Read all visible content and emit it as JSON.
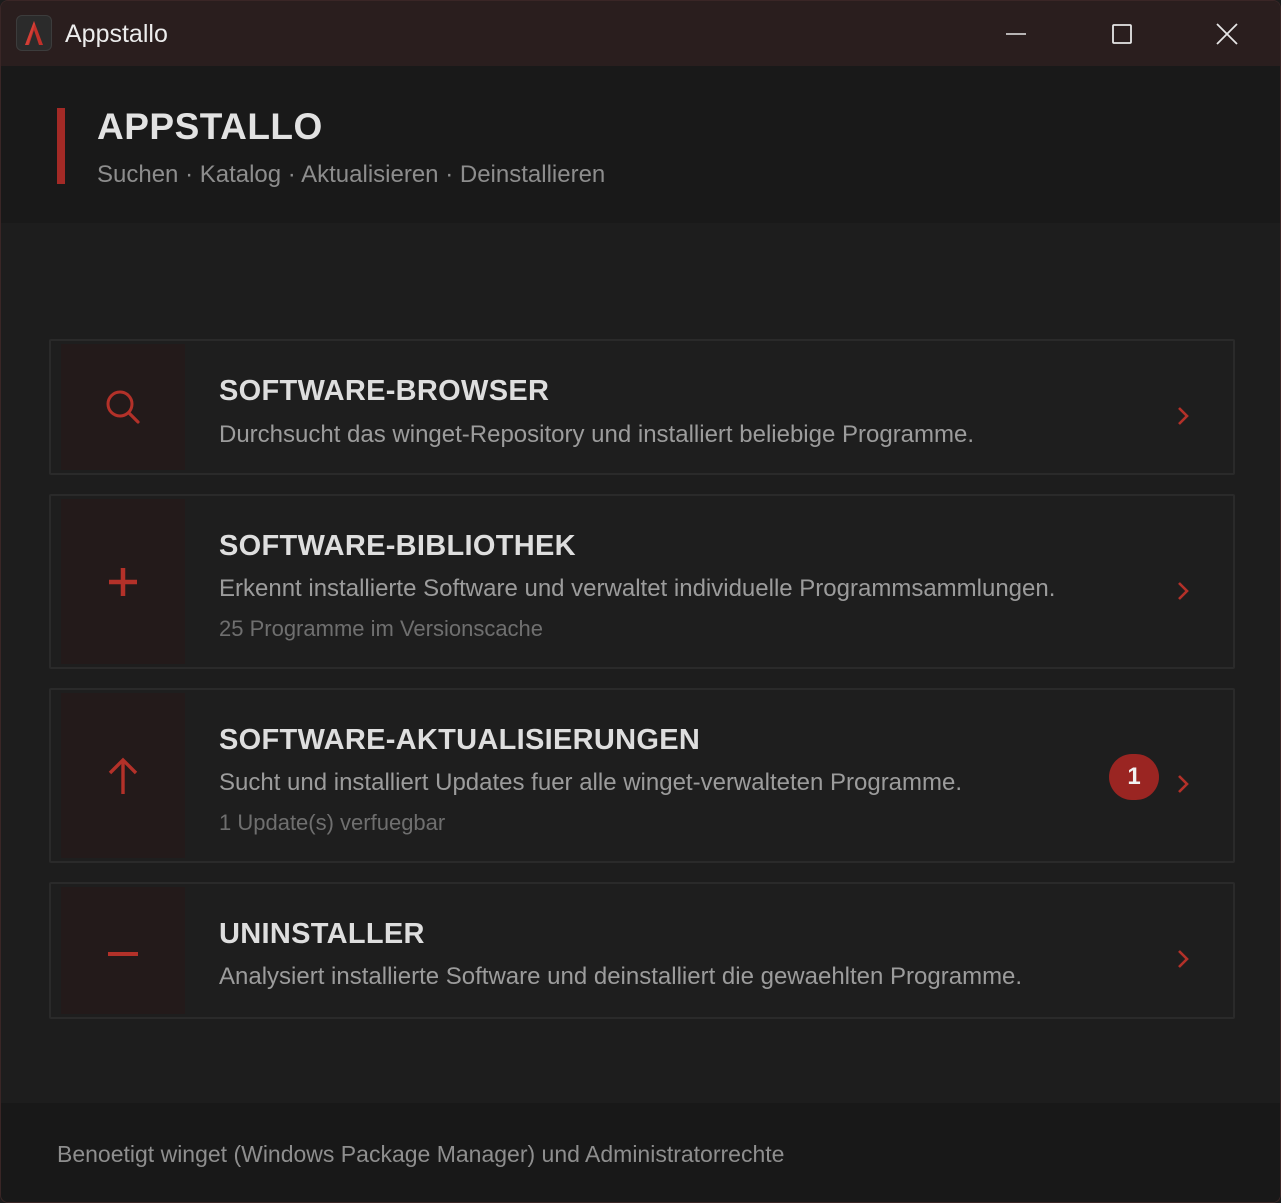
{
  "window": {
    "title": "Appstallo",
    "controls": {
      "minimize": "minimize",
      "maximize": "maximize",
      "close": "close"
    }
  },
  "header": {
    "title": "APPSTALLO",
    "subtitle": "Suchen · Katalog · Aktualisieren · Deinstallieren"
  },
  "cards": [
    {
      "title": "SOFTWARE-BROWSER",
      "description": "Durchsucht das winget-Repository und installiert beliebige Programme.",
      "icon": "search-icon"
    },
    {
      "title": "SOFTWARE-BIBLIOTHEK",
      "description": "Erkennt installierte Software und verwaltet individuelle Programmsammlungen.",
      "meta": "25 Programme im Versionscache",
      "icon": "plus-icon"
    },
    {
      "title": "SOFTWARE-AKTUALISIERUNGEN",
      "description": "Sucht und installiert Updates fuer alle winget-verwalteten Programme.",
      "meta": "1 Update(s) verfuegbar",
      "badge": "1",
      "icon": "arrow-up-icon"
    },
    {
      "title": "UNINSTALLER",
      "description": "Analysiert installierte Software und deinstalliert die gewaehlten Programme.",
      "icon": "minus-icon"
    }
  ],
  "footer": {
    "text": "Benoetigt winget (Windows Package Manager) und Administratorrechte"
  },
  "colors": {
    "accent": "#a32a26",
    "badge": "#9a2522",
    "background": "#1d1d1d",
    "titlebar": "#2a1e1e"
  }
}
